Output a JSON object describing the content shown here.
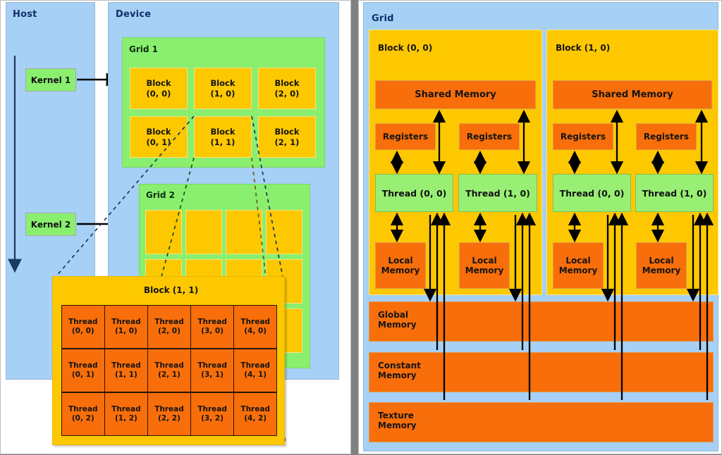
{
  "left_panel": {
    "host": {
      "title": "Host",
      "kernels": [
        {
          "label": "Kernel 1"
        },
        {
          "label": "Kernel 2"
        }
      ]
    },
    "device": {
      "title": "Device",
      "grids": [
        {
          "label": "Grid 1",
          "blocks": [
            {
              "line1": "Block",
              "line2": "(0, 0)"
            },
            {
              "line1": "Block",
              "line2": "(1, 0)"
            },
            {
              "line1": "Block",
              "line2": "(2, 0)"
            },
            {
              "line1": "Block",
              "line2": "(0, 1)"
            },
            {
              "line1": "Block",
              "line2": "(1, 1)"
            },
            {
              "line1": "Block",
              "line2": "(2, 1)"
            }
          ]
        },
        {
          "label": "Grid 2",
          "blocks_unlabeled_rows": 3,
          "blocks_unlabeled_cols": 4
        }
      ]
    },
    "detail": {
      "title": "Block (1, 1)",
      "threads": [
        "Thread (0, 0)",
        "Thread (1, 0)",
        "Thread (2, 0)",
        "Thread (3, 0)",
        "Thread (4, 0)",
        "Thread (0, 1)",
        "Thread (1, 1)",
        "Thread (2, 1)",
        "Thread (3, 1)",
        "Thread (4, 1)",
        "Thread (0, 2)",
        "Thread (1, 2)",
        "Thread (2, 2)",
        "Thread (3, 2)",
        "Thread (4, 2)"
      ],
      "thread_cells": [
        {
          "line1": "Thread",
          "line2": "(0, 0)"
        },
        {
          "line1": "Thread",
          "line2": "(1, 0)"
        },
        {
          "line1": "Thread",
          "line2": "(2, 0)"
        },
        {
          "line1": "Thread",
          "line2": "(3, 0)"
        },
        {
          "line1": "Thread",
          "line2": "(4, 0)"
        },
        {
          "line1": "Thread",
          "line2": "(0, 1)"
        },
        {
          "line1": "Thread",
          "line2": "(1, 1)"
        },
        {
          "line1": "Thread",
          "line2": "(2, 1)"
        },
        {
          "line1": "Thread",
          "line2": "(3, 1)"
        },
        {
          "line1": "Thread",
          "line2": "(4, 1)"
        },
        {
          "line1": "Thread",
          "line2": "(0, 2)"
        },
        {
          "line1": "Thread",
          "line2": "(1, 2)"
        },
        {
          "line1": "Thread",
          "line2": "(2, 2)"
        },
        {
          "line1": "Thread",
          "line2": "(3, 2)"
        },
        {
          "line1": "Thread",
          "line2": "(4, 2)"
        }
      ]
    }
  },
  "right_panel": {
    "title": "Grid",
    "blocks": [
      {
        "title": "Block (0, 0)",
        "shared_memory": "Shared Memory",
        "lanes": [
          {
            "registers": "Registers",
            "thread": "Thread (0, 0)",
            "local_l1": "Local",
            "local_l2": "Memory"
          },
          {
            "registers": "Registers",
            "thread": "Thread (1, 0)",
            "local_l1": "Local",
            "local_l2": "Memory"
          }
        ]
      },
      {
        "title": "Block (1, 0)",
        "shared_memory": "Shared Memory",
        "lanes": [
          {
            "registers": "Registers",
            "thread": "Thread (0, 0)",
            "local_l1": "Local",
            "local_l2": "Memory"
          },
          {
            "registers": "Registers",
            "thread": "Thread (1, 0)",
            "local_l1": "Local",
            "local_l2": "Memory"
          }
        ]
      }
    ],
    "global_memories": [
      {
        "line1": "Global",
        "line2": "Memory"
      },
      {
        "line1": "Constant",
        "line2": "Memory"
      },
      {
        "line1": "Texture",
        "line2": "Memory"
      }
    ]
  },
  "colors": {
    "backdrop": "#808080",
    "panel_bg": "#ffffff",
    "host_blue": "#a6d0f5",
    "grid_green": "#8aef6f",
    "block_yellow": "#fdc800",
    "memory_orange": "#f86e0a",
    "thread_green": "#99ef73",
    "arrow_dark": "#000000",
    "title_navy": "#11306b"
  }
}
